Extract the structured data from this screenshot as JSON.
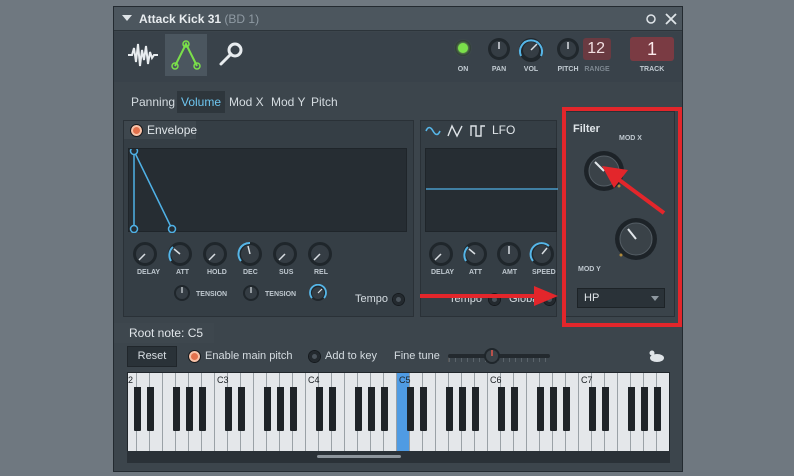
{
  "window": {
    "title": "Attack Kick 31",
    "subtitle": "(BD 1)",
    "pin_icon": "pin-icon",
    "close_icon": "close-icon"
  },
  "toolbar": {
    "tabs": [
      {
        "name": "waveform-icon"
      },
      {
        "name": "envelope-icon"
      },
      {
        "name": "wrench-icon"
      }
    ],
    "knobs": [
      {
        "label": "ON"
      },
      {
        "label": "PAN"
      },
      {
        "label": "VOL"
      },
      {
        "label": "PITCH"
      }
    ],
    "range_value": "12",
    "range_label": "RANGE",
    "track_value": "1",
    "track_label": "TRACK"
  },
  "tabs": [
    "Panning",
    "Volume",
    "Mod X",
    "Mod Y",
    "Pitch"
  ],
  "active_tab": "Volume",
  "envelope": {
    "label": "Envelope",
    "knobs": [
      "DELAY",
      "ATT",
      "HOLD",
      "DEC",
      "SUS",
      "REL"
    ],
    "tension_label": "TENSION",
    "tempo_label": "Tempo"
  },
  "lfo": {
    "label": "LFO",
    "knobs": [
      "DELAY",
      "ATT",
      "AMT",
      "SPEED"
    ],
    "tempo_label": "Tempo",
    "global_label": "Global"
  },
  "filter": {
    "label": "Filter",
    "mod_x_label": "MOD X",
    "mod_y_label": "MOD Y",
    "type_value": "HP"
  },
  "root_note": {
    "label": "Root note: C5",
    "reset_label": "Reset",
    "enable_main_pitch_label": "Enable main pitch",
    "add_to_key_label": "Add to key",
    "fine_tune_label": "Fine tune"
  },
  "keyboard": {
    "octave_labels": [
      "2",
      "C3",
      "C4",
      "C5",
      "C6",
      "C7"
    ],
    "active_key": "C5"
  },
  "colors": {
    "accent": "#6ec6f0",
    "highlight": "#e3262b",
    "led_green": "#7be04a",
    "orange_radio": "#e3714c"
  }
}
